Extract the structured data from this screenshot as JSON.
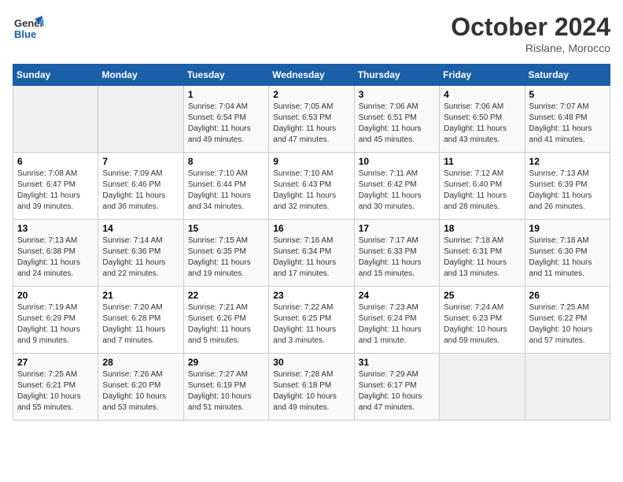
{
  "header": {
    "logo_line1": "General",
    "logo_line2": "Blue",
    "month_title": "October 2024",
    "subtitle": "Rislane, Morocco"
  },
  "weekdays": [
    "Sunday",
    "Monday",
    "Tuesday",
    "Wednesday",
    "Thursday",
    "Friday",
    "Saturday"
  ],
  "weeks": [
    [
      {
        "day": "",
        "sunrise": "",
        "sunset": "",
        "daylight": ""
      },
      {
        "day": "",
        "sunrise": "",
        "sunset": "",
        "daylight": ""
      },
      {
        "day": "1",
        "sunrise": "Sunrise: 7:04 AM",
        "sunset": "Sunset: 6:54 PM",
        "daylight": "Daylight: 11 hours and 49 minutes."
      },
      {
        "day": "2",
        "sunrise": "Sunrise: 7:05 AM",
        "sunset": "Sunset: 6:53 PM",
        "daylight": "Daylight: 11 hours and 47 minutes."
      },
      {
        "day": "3",
        "sunrise": "Sunrise: 7:06 AM",
        "sunset": "Sunset: 6:51 PM",
        "daylight": "Daylight: 11 hours and 45 minutes."
      },
      {
        "day": "4",
        "sunrise": "Sunrise: 7:06 AM",
        "sunset": "Sunset: 6:50 PM",
        "daylight": "Daylight: 11 hours and 43 minutes."
      },
      {
        "day": "5",
        "sunrise": "Sunrise: 7:07 AM",
        "sunset": "Sunset: 6:48 PM",
        "daylight": "Daylight: 11 hours and 41 minutes."
      }
    ],
    [
      {
        "day": "6",
        "sunrise": "Sunrise: 7:08 AM",
        "sunset": "Sunset: 6:47 PM",
        "daylight": "Daylight: 11 hours and 39 minutes."
      },
      {
        "day": "7",
        "sunrise": "Sunrise: 7:09 AM",
        "sunset": "Sunset: 6:46 PM",
        "daylight": "Daylight: 11 hours and 36 minutes."
      },
      {
        "day": "8",
        "sunrise": "Sunrise: 7:10 AM",
        "sunset": "Sunset: 6:44 PM",
        "daylight": "Daylight: 11 hours and 34 minutes."
      },
      {
        "day": "9",
        "sunrise": "Sunrise: 7:10 AM",
        "sunset": "Sunset: 6:43 PM",
        "daylight": "Daylight: 11 hours and 32 minutes."
      },
      {
        "day": "10",
        "sunrise": "Sunrise: 7:11 AM",
        "sunset": "Sunset: 6:42 PM",
        "daylight": "Daylight: 11 hours and 30 minutes."
      },
      {
        "day": "11",
        "sunrise": "Sunrise: 7:12 AM",
        "sunset": "Sunset: 6:40 PM",
        "daylight": "Daylight: 11 hours and 28 minutes."
      },
      {
        "day": "12",
        "sunrise": "Sunrise: 7:13 AM",
        "sunset": "Sunset: 6:39 PM",
        "daylight": "Daylight: 11 hours and 26 minutes."
      }
    ],
    [
      {
        "day": "13",
        "sunrise": "Sunrise: 7:13 AM",
        "sunset": "Sunset: 6:38 PM",
        "daylight": "Daylight: 11 hours and 24 minutes."
      },
      {
        "day": "14",
        "sunrise": "Sunrise: 7:14 AM",
        "sunset": "Sunset: 6:36 PM",
        "daylight": "Daylight: 11 hours and 22 minutes."
      },
      {
        "day": "15",
        "sunrise": "Sunrise: 7:15 AM",
        "sunset": "Sunset: 6:35 PM",
        "daylight": "Daylight: 11 hours and 19 minutes."
      },
      {
        "day": "16",
        "sunrise": "Sunrise: 7:16 AM",
        "sunset": "Sunset: 6:34 PM",
        "daylight": "Daylight: 11 hours and 17 minutes."
      },
      {
        "day": "17",
        "sunrise": "Sunrise: 7:17 AM",
        "sunset": "Sunset: 6:33 PM",
        "daylight": "Daylight: 11 hours and 15 minutes."
      },
      {
        "day": "18",
        "sunrise": "Sunrise: 7:18 AM",
        "sunset": "Sunset: 6:31 PM",
        "daylight": "Daylight: 11 hours and 13 minutes."
      },
      {
        "day": "19",
        "sunrise": "Sunrise: 7:18 AM",
        "sunset": "Sunset: 6:30 PM",
        "daylight": "Daylight: 11 hours and 11 minutes."
      }
    ],
    [
      {
        "day": "20",
        "sunrise": "Sunrise: 7:19 AM",
        "sunset": "Sunset: 6:29 PM",
        "daylight": "Daylight: 11 hours and 9 minutes."
      },
      {
        "day": "21",
        "sunrise": "Sunrise: 7:20 AM",
        "sunset": "Sunset: 6:28 PM",
        "daylight": "Daylight: 11 hours and 7 minutes."
      },
      {
        "day": "22",
        "sunrise": "Sunrise: 7:21 AM",
        "sunset": "Sunset: 6:26 PM",
        "daylight": "Daylight: 11 hours and 5 minutes."
      },
      {
        "day": "23",
        "sunrise": "Sunrise: 7:22 AM",
        "sunset": "Sunset: 6:25 PM",
        "daylight": "Daylight: 11 hours and 3 minutes."
      },
      {
        "day": "24",
        "sunrise": "Sunrise: 7:23 AM",
        "sunset": "Sunset: 6:24 PM",
        "daylight": "Daylight: 11 hours and 1 minute."
      },
      {
        "day": "25",
        "sunrise": "Sunrise: 7:24 AM",
        "sunset": "Sunset: 6:23 PM",
        "daylight": "Daylight: 10 hours and 59 minutes."
      },
      {
        "day": "26",
        "sunrise": "Sunrise: 7:25 AM",
        "sunset": "Sunset: 6:22 PM",
        "daylight": "Daylight: 10 hours and 57 minutes."
      }
    ],
    [
      {
        "day": "27",
        "sunrise": "Sunrise: 7:25 AM",
        "sunset": "Sunset: 6:21 PM",
        "daylight": "Daylight: 10 hours and 55 minutes."
      },
      {
        "day": "28",
        "sunrise": "Sunrise: 7:26 AM",
        "sunset": "Sunset: 6:20 PM",
        "daylight": "Daylight: 10 hours and 53 minutes."
      },
      {
        "day": "29",
        "sunrise": "Sunrise: 7:27 AM",
        "sunset": "Sunset: 6:19 PM",
        "daylight": "Daylight: 10 hours and 51 minutes."
      },
      {
        "day": "30",
        "sunrise": "Sunrise: 7:28 AM",
        "sunset": "Sunset: 6:18 PM",
        "daylight": "Daylight: 10 hours and 49 minutes."
      },
      {
        "day": "31",
        "sunrise": "Sunrise: 7:29 AM",
        "sunset": "Sunset: 6:17 PM",
        "daylight": "Daylight: 10 hours and 47 minutes."
      },
      {
        "day": "",
        "sunrise": "",
        "sunset": "",
        "daylight": ""
      },
      {
        "day": "",
        "sunrise": "",
        "sunset": "",
        "daylight": ""
      }
    ]
  ]
}
